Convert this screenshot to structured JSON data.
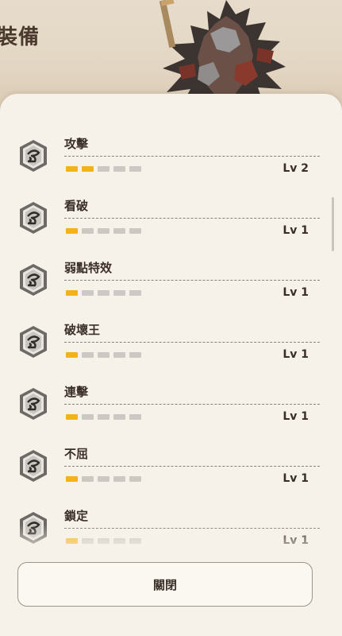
{
  "header": {
    "title": "裝備"
  },
  "skills": [
    {
      "name": "攻擊",
      "level_label": "Lv 2",
      "level": 2,
      "max_level": 5
    },
    {
      "name": "看破",
      "level_label": "Lv 1",
      "level": 1,
      "max_level": 5
    },
    {
      "name": "弱點特效",
      "level_label": "Lv 1",
      "level": 1,
      "max_level": 5
    },
    {
      "name": "破壞王",
      "level_label": "Lv 1",
      "level": 1,
      "max_level": 5
    },
    {
      "name": "連擊",
      "level_label": "Lv 1",
      "level": 1,
      "max_level": 5
    },
    {
      "name": "不屈",
      "level_label": "Lv 1",
      "level": 1,
      "max_level": 5
    },
    {
      "name": "鎖定",
      "level_label": "Lv 1",
      "level": 1,
      "max_level": 5
    }
  ],
  "close_button": {
    "label": "關閉"
  },
  "colors": {
    "level_on": "#f3b21a",
    "level_off": "#cdc8c4",
    "panel": "#f7f2e9"
  },
  "icons": {
    "skill": "skill-emblem-icon"
  }
}
